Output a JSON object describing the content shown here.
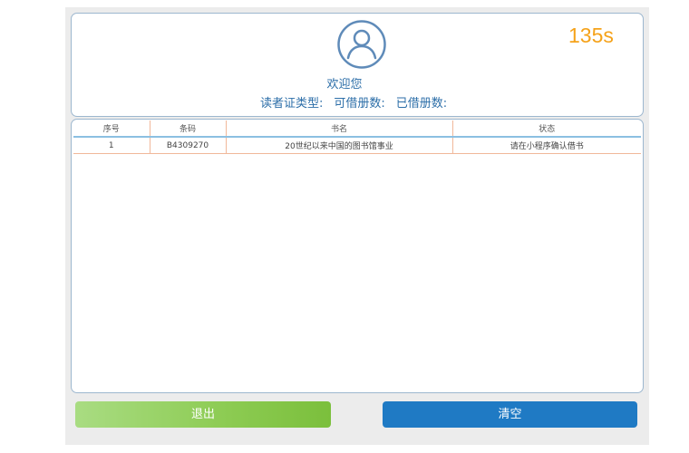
{
  "header": {
    "timer": "135s",
    "welcome": "欢迎您",
    "card_type_label": "读者证类型:",
    "borrowable_label": "可借册数:",
    "borrowed_label": "已借册数:"
  },
  "table": {
    "columns": [
      "序号",
      "条码",
      "书名",
      "状态"
    ],
    "rows": [
      [
        "1",
        "B4309270",
        "20世纪以来中国的图书馆事业",
        "请在小程序确认借书"
      ]
    ]
  },
  "buttons": {
    "exit": "退出",
    "clear": "清空"
  },
  "colors": {
    "accent_blue": "#2c6ea8",
    "timer_orange": "#f5a21a",
    "exit_green": "#8ccb52",
    "clear_blue": "#1f7ac4"
  },
  "icons": {
    "avatar": "user-avatar-icon"
  }
}
